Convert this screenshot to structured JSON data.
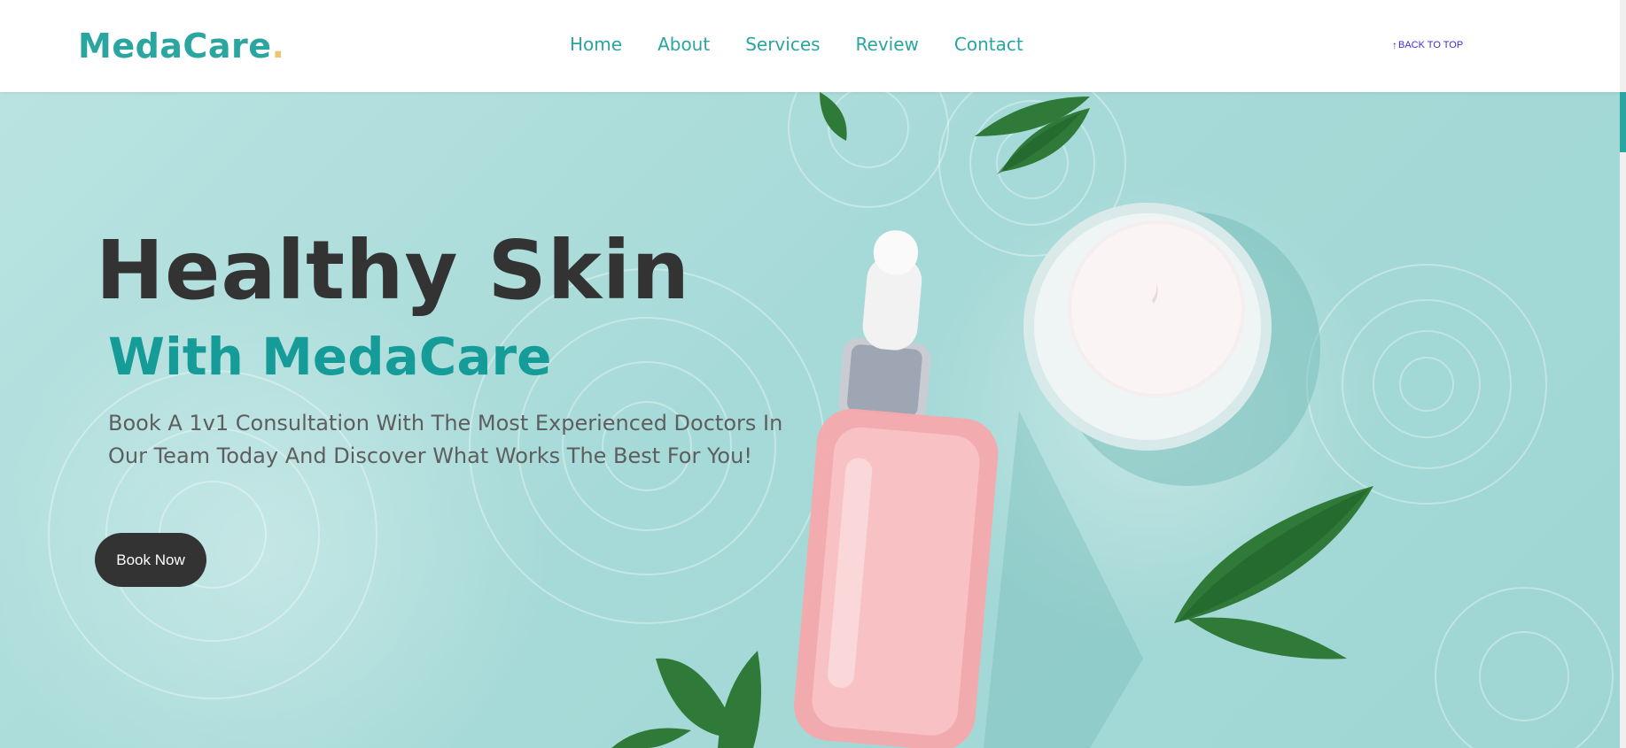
{
  "header": {
    "logo_text": "MedaCare",
    "logo_dot": ".",
    "nav": [
      {
        "label": "Home"
      },
      {
        "label": "About"
      },
      {
        "label": "Services"
      },
      {
        "label": "Review"
      },
      {
        "label": "Contact"
      }
    ],
    "back_to_top": "BACK TO TOP"
  },
  "hero": {
    "title": "Healthy Skin",
    "subtitle": "With MedaCare",
    "description": "Book A 1v1 Consultation With The Most Experienced Doctors In Our Team Today And Discover What Works The Best For You!",
    "cta_label": "Book Now"
  },
  "colors": {
    "brand": "#2aa5a0",
    "accent_dot": "#f0c470",
    "heading": "#333333",
    "subtitle": "#159c98",
    "body_text": "#5e5e5e",
    "button_bg": "#333333",
    "back_to_top": "#3a2fd6",
    "hero_bg": "#a6dad8"
  },
  "icons": {
    "back_to_top": "arrow-up-icon"
  }
}
